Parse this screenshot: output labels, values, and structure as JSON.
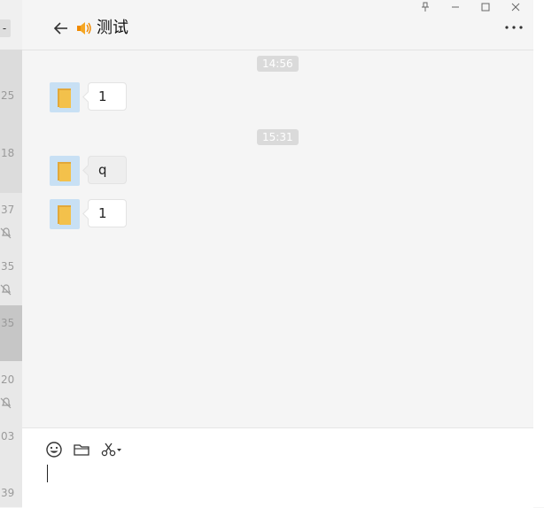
{
  "window": {
    "title": "测试"
  },
  "sidebar_partial": {
    "items": [
      "25",
      "18",
      "37",
      "35",
      "35",
      "20",
      "03",
      "39"
    ],
    "mini_button": "-"
  },
  "messages": {
    "groups": [
      {
        "time": "14:56",
        "items": [
          {
            "text": "1",
            "style": "white"
          }
        ]
      },
      {
        "time": "15:31",
        "items": [
          {
            "text": "q",
            "style": "gray"
          },
          {
            "text": "1",
            "style": "white"
          }
        ]
      }
    ]
  },
  "toolbar": {
    "icons": [
      "emoji-icon",
      "folder-icon",
      "scissors-icon"
    ]
  },
  "colors": {
    "background": "#f5f5f5",
    "input_bg": "#ffffff",
    "time_badge": "#dadada",
    "avatar": "#c8e0f4",
    "folder": "#f3c14b"
  }
}
